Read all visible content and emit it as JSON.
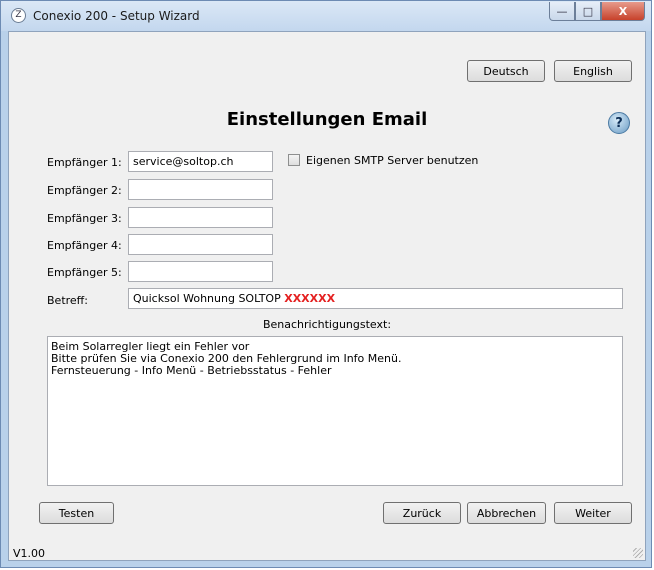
{
  "window": {
    "title": "Conexio 200 - Setup Wizard",
    "icon_letter": "Z",
    "buttons": {
      "minimize": "—",
      "maximize": "□",
      "close": "X"
    }
  },
  "language": {
    "german": "Deutsch",
    "english": "English"
  },
  "heading": "Einstellungen Email",
  "help": "?",
  "recipients": [
    {
      "label": "Empfänger 1:",
      "value": "service@soltop.ch"
    },
    {
      "label": "Empfänger 2:",
      "value": ""
    },
    {
      "label": "Empfänger 3:",
      "value": ""
    },
    {
      "label": "Empfänger 4:",
      "value": ""
    },
    {
      "label": "Empfänger 5:",
      "value": ""
    }
  ],
  "smtp_checkbox": {
    "label": "Eigenen SMTP Server benutzen",
    "checked": false
  },
  "subject": {
    "label": "Betreff:",
    "value": "Quicksol Wohnung SOLTOP ",
    "highlight": "XXXXXX"
  },
  "notification": {
    "label": "Benachrichtigungstext:",
    "lines": [
      "Beim Solarregler liegt ein Fehler vor",
      "Bitte prüfen Sie via Conexio 200 den Fehlergrund im Info Menü.",
      "Fernsteuerung - Info Menü - Betriebsstatus - Fehler"
    ]
  },
  "buttons": {
    "test": "Testen",
    "back": "Zurück",
    "cancel": "Abbrechen",
    "next": "Weiter"
  },
  "version": "V1.00",
  "colors": {
    "highlight": "#e42020",
    "window_frame": "#b9d1ea",
    "close_button": "#c7422b"
  }
}
